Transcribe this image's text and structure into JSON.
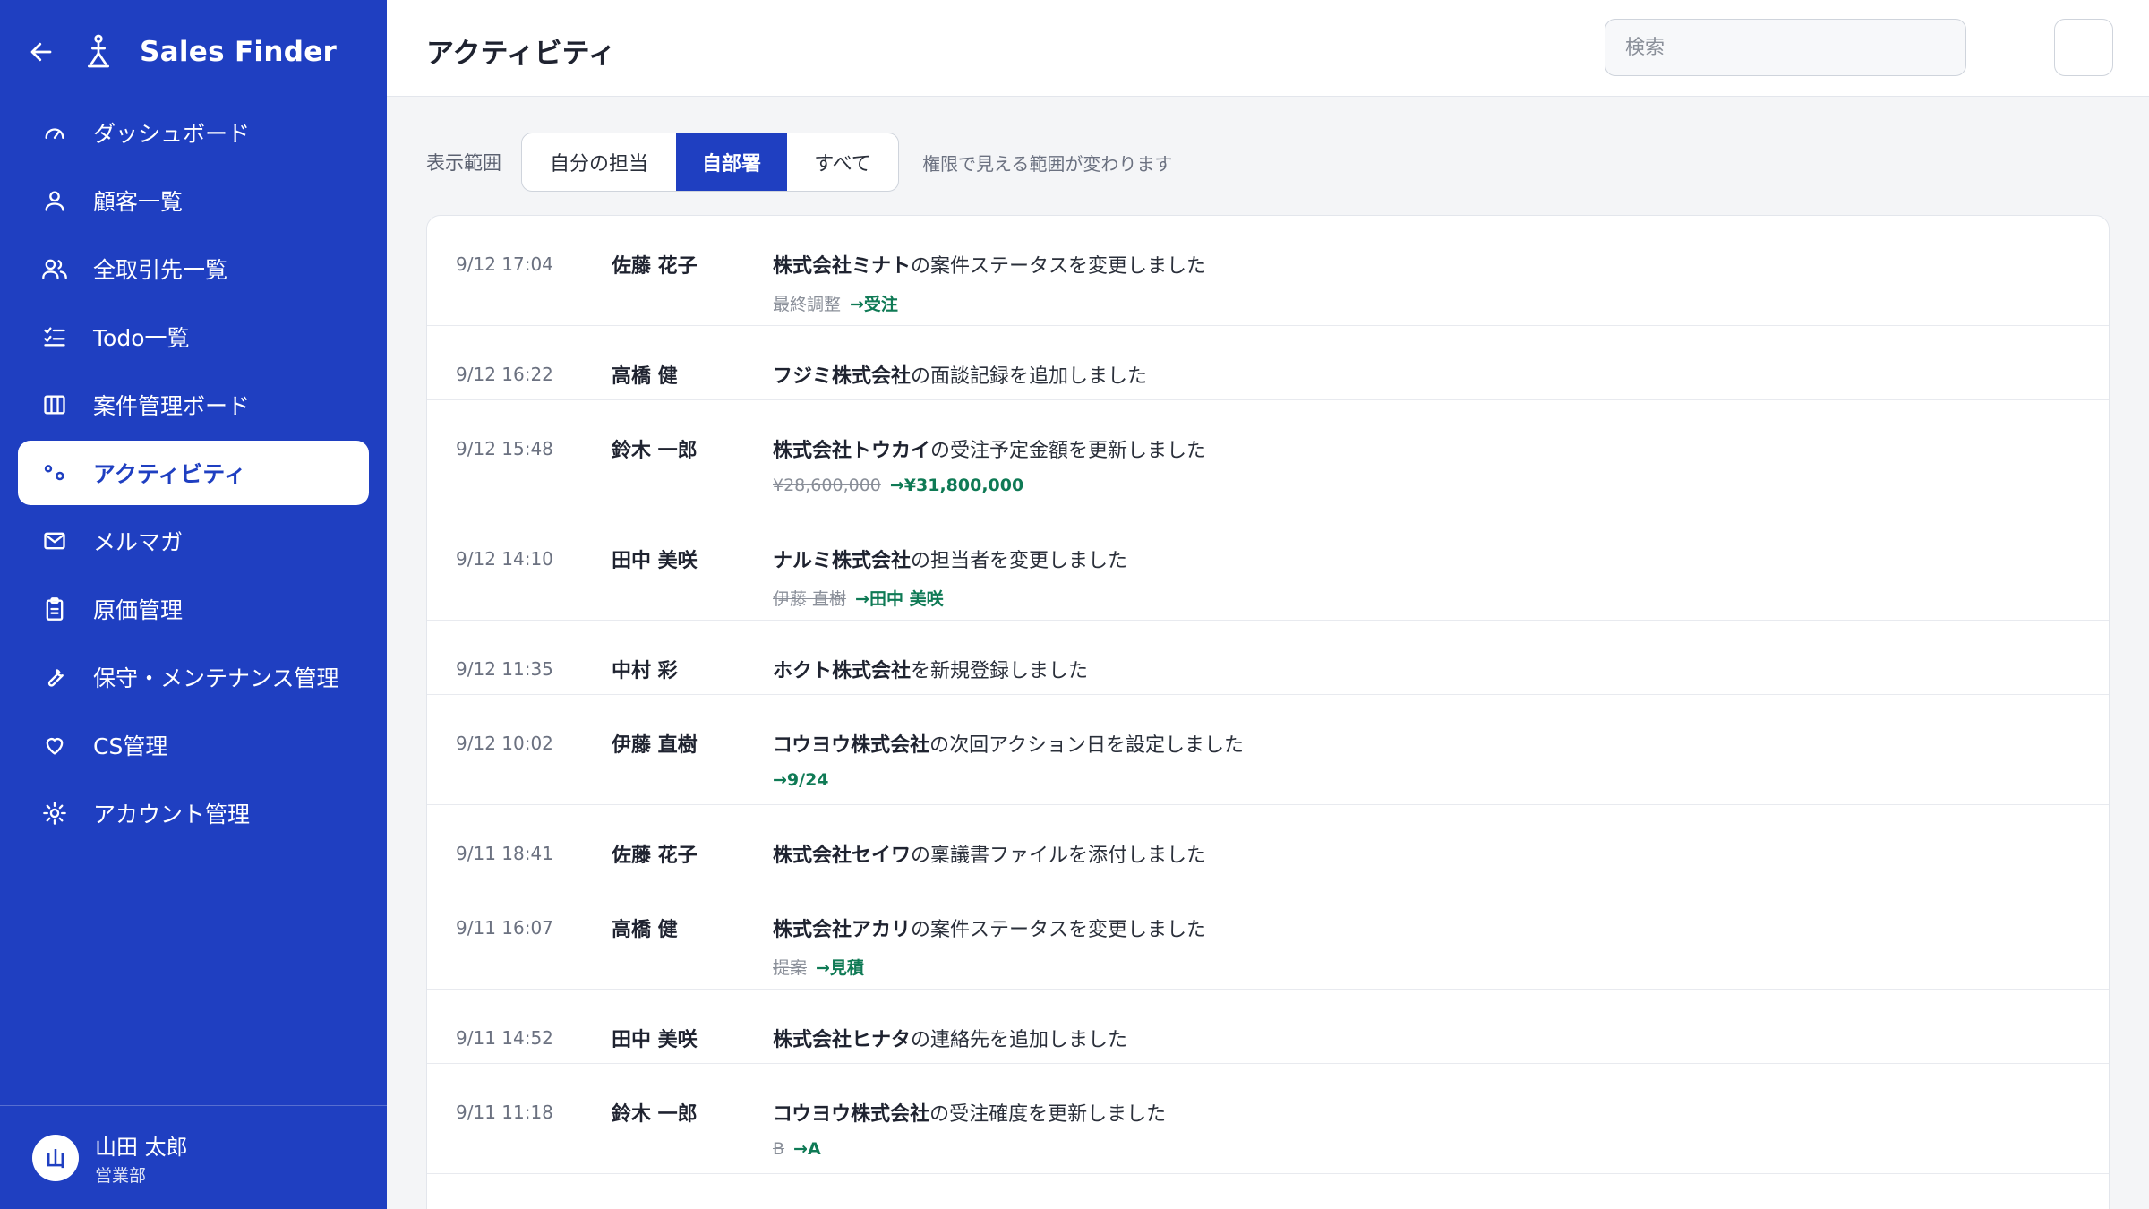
{
  "app": {
    "name": "Sales Finder"
  },
  "sidebar": {
    "items": [
      {
        "label": "ダッシュボード",
        "icon": "gauge-icon"
      },
      {
        "label": "顧客一覧",
        "icon": "user-icon"
      },
      {
        "label": "全取引先一覧",
        "icon": "users-icon"
      },
      {
        "label": "Todo一覧",
        "icon": "checklist-icon"
      },
      {
        "label": "案件管理ボード",
        "icon": "kanban-icon"
      },
      {
        "label": "アクティビティ",
        "icon": "activity-icon",
        "active": true
      },
      {
        "label": "メルマガ",
        "icon": "mail-icon"
      },
      {
        "label": "原価管理",
        "icon": "clipboard-icon"
      },
      {
        "label": "保守・メンテナンス管理",
        "icon": "wrench-icon"
      },
      {
        "label": "CS管理",
        "icon": "heart-icon"
      },
      {
        "label": "アカウント管理",
        "icon": "gear-icon"
      }
    ]
  },
  "user": {
    "initial": "山",
    "name": "山田 太郎",
    "dept": "営業部"
  },
  "header": {
    "title": "アクティビティ",
    "search_placeholder": "検索"
  },
  "filter": {
    "label": "表示範囲",
    "options": [
      "自分の担当",
      "自部署",
      "すべて"
    ],
    "selected": "自部署",
    "hint": "権限で見える範囲が変わります"
  },
  "activities": [
    {
      "time": "9/12 17:04",
      "actor": "佐藤 花子",
      "target": "株式会社ミナト",
      "action": "の案件ステータスを変更しました",
      "old": "最終調整",
      "new": "→受注"
    },
    {
      "time": "9/12 16:22",
      "actor": "高橋 健",
      "target": "フジミ株式会社",
      "action": "の面談記録を追加しました"
    },
    {
      "time": "9/12 15:48",
      "actor": "鈴木 一郎",
      "target": "株式会社トウカイ",
      "action": "の受注予定金額を更新しました",
      "old": "¥28,600,000",
      "new": "→¥31,800,000"
    },
    {
      "time": "9/12 14:10",
      "actor": "田中 美咲",
      "target": "ナルミ株式会社",
      "action": "の担当者を変更しました",
      "old": "伊藤 直樹",
      "new": "→田中 美咲"
    },
    {
      "time": "9/12 11:35",
      "actor": "中村 彩",
      "target": "ホクト株式会社",
      "action": "を新規登録しました"
    },
    {
      "time": "9/12 10:02",
      "actor": "伊藤 直樹",
      "target": "コウヨウ株式会社",
      "action": "の次回アクション日を設定しました",
      "new": "→9/24"
    },
    {
      "time": "9/11 18:41",
      "actor": "佐藤 花子",
      "target": "株式会社セイワ",
      "action": "の稟議書ファイルを添付しました"
    },
    {
      "time": "9/11 16:07",
      "actor": "高橋 健",
      "target": "株式会社アカリ",
      "action": "の案件ステータスを変更しました",
      "old": "提案",
      "new": "→見積"
    },
    {
      "time": "9/11 14:52",
      "actor": "田中 美咲",
      "target": "株式会社ヒナタ",
      "action": "の連絡先を追加しました"
    },
    {
      "time": "9/11 11:18",
      "actor": "鈴木 一郎",
      "target": "コウヨウ株式会社",
      "action": "の受注確度を更新しました",
      "old": "B",
      "new": "→A"
    }
  ],
  "colors": {
    "primary": "#1f3fc1",
    "positive": "#0f7a55"
  }
}
